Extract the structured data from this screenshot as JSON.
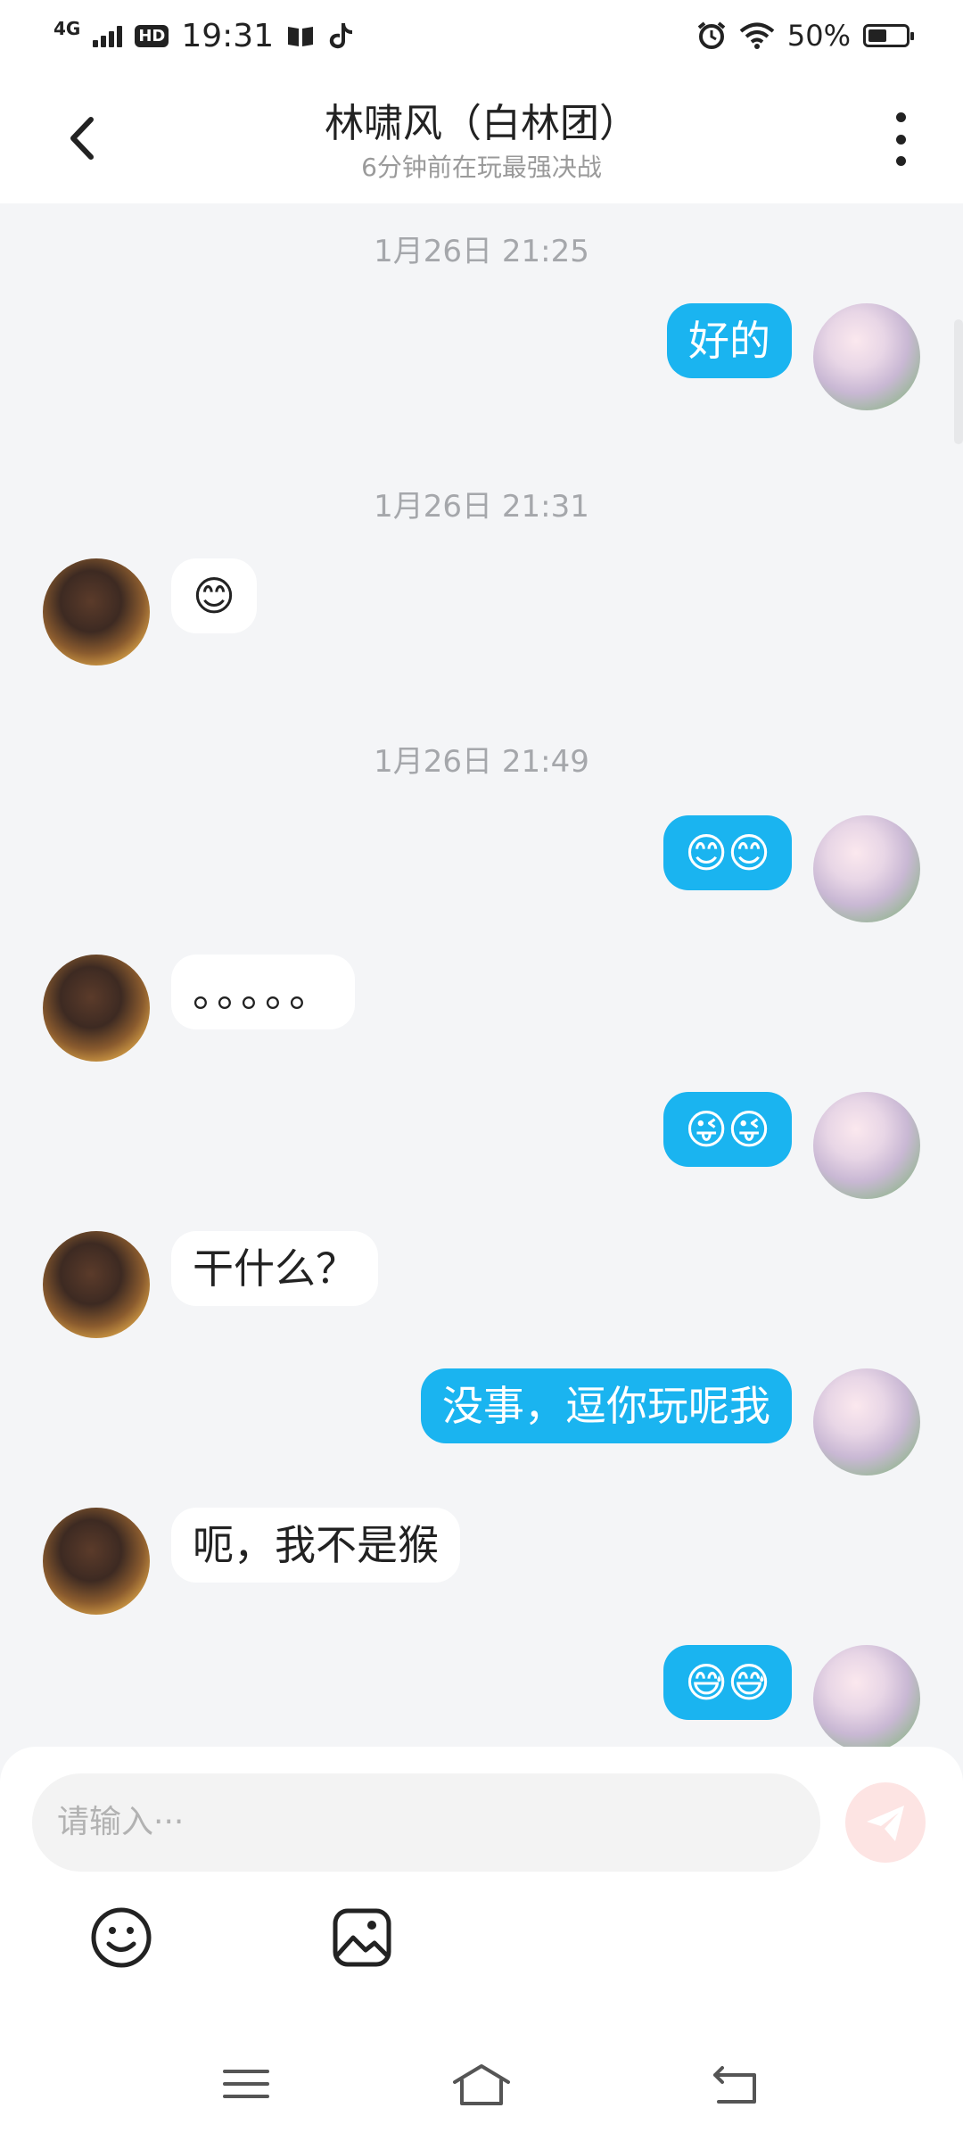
{
  "status_bar": {
    "network": "4G",
    "hd": "HD",
    "time": "19:31",
    "battery": "50%",
    "battery_level": 0.5
  },
  "header": {
    "title": "林啸风（白林团）",
    "subtitle": "6分钟前在玩最强决战"
  },
  "messages": [
    {
      "kind": "timestamp",
      "text": "1月26日  21:25"
    },
    {
      "kind": "message",
      "side": "out",
      "text": "好的"
    },
    {
      "kind": "timestamp",
      "text": "1月26日  21:31"
    },
    {
      "kind": "message",
      "side": "in",
      "text": "😊"
    },
    {
      "kind": "timestamp",
      "text": "1月26日  21:49"
    },
    {
      "kind": "message",
      "side": "out",
      "text": "😊😊"
    },
    {
      "kind": "message",
      "side": "in",
      "text": "。。。。。"
    },
    {
      "kind": "message",
      "side": "out",
      "text": "😜😜"
    },
    {
      "kind": "message",
      "side": "in",
      "text": "干什么？"
    },
    {
      "kind": "message",
      "side": "out",
      "text": "没事，逗你玩呢我"
    },
    {
      "kind": "message",
      "side": "in",
      "text": "呃，我不是猴"
    },
    {
      "kind": "message",
      "side": "out",
      "text": "😅😅"
    }
  ],
  "composer": {
    "placeholder": "请输入···",
    "send_icon": "send-icon",
    "emoji_icon": "smiley-icon",
    "image_icon": "image-icon"
  },
  "nav_bar": {
    "icons": [
      "menu-icon",
      "home-icon",
      "back-icon"
    ]
  }
}
